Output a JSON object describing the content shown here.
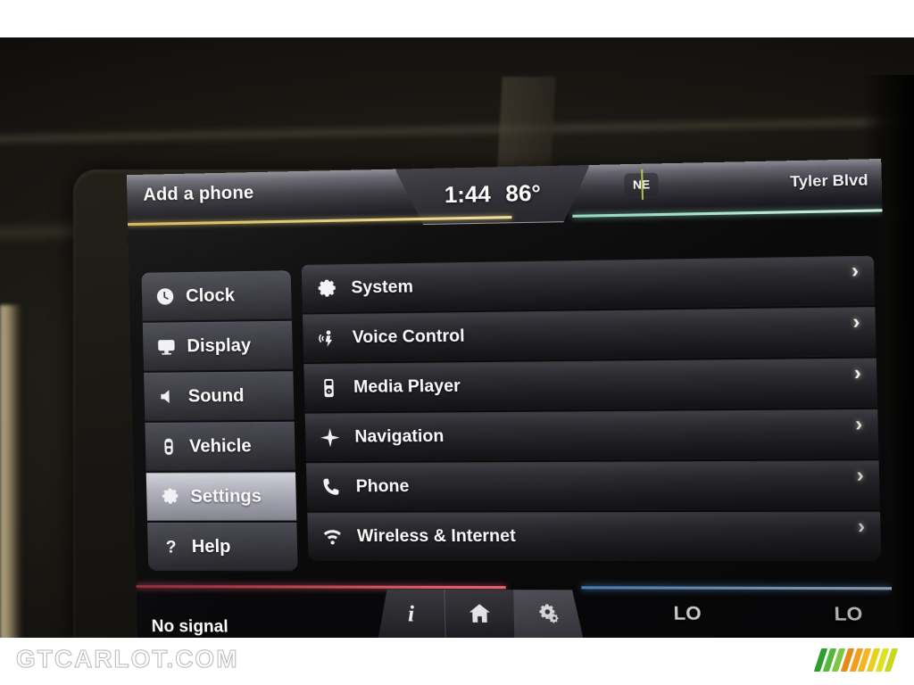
{
  "header": {
    "left_status": "Add a phone",
    "clock": "1:44",
    "temperature": "86°",
    "compass": "NE",
    "location": "Tyler Blvd"
  },
  "sidebar": {
    "items": [
      {
        "label": "Clock",
        "icon": "clock-icon",
        "active": false
      },
      {
        "label": "Display",
        "icon": "display-icon",
        "active": false
      },
      {
        "label": "Sound",
        "icon": "sound-icon",
        "active": false
      },
      {
        "label": "Vehicle",
        "icon": "vehicle-icon",
        "active": false
      },
      {
        "label": "Settings",
        "icon": "gear-icon",
        "active": true
      },
      {
        "label": "Help",
        "icon": "question-icon",
        "active": false
      }
    ]
  },
  "main": {
    "rows": [
      {
        "label": "System",
        "icon": "gear-icon",
        "chevron": "›"
      },
      {
        "label": "Voice Control",
        "icon": "voice-icon",
        "chevron": "›"
      },
      {
        "label": "Media Player",
        "icon": "media-player-icon",
        "chevron": "›"
      },
      {
        "label": "Navigation",
        "icon": "compass-star-icon",
        "chevron": "›"
      },
      {
        "label": "Phone",
        "icon": "phone-icon",
        "chevron": "›"
      },
      {
        "label": "Wireless & Internet",
        "icon": "wifi-icon",
        "chevron": "›"
      }
    ]
  },
  "footer": {
    "status": "No signal",
    "tray": [
      {
        "name": "info-icon",
        "glyph": "i",
        "active": false
      },
      {
        "name": "home-icon",
        "glyph": "",
        "active": false
      },
      {
        "name": "settings-icon",
        "glyph": "",
        "active": true
      }
    ],
    "temp_left": "LO",
    "temp_right": "LO"
  },
  "watermark": {
    "text": "GTCARLOT.COM",
    "bar_colors": [
      "#2f9e2f",
      "#54b83a",
      "#7fc742",
      "#e58a18",
      "#f0a01e",
      "#f5b422",
      "#e8d11d",
      "#dfe020",
      "#c9d81d"
    ]
  },
  "colors": {
    "accent_yellow": "#d3b551",
    "accent_green": "#8fd9bb",
    "accent_red": "#f06a78",
    "accent_blue": "#4b8fd6",
    "compass_tick": "#b8d84a"
  }
}
